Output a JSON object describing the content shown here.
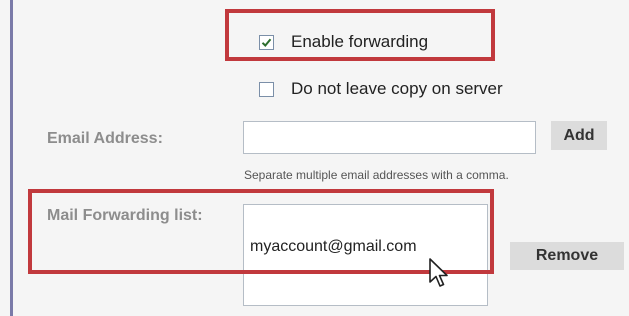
{
  "forwarding": {
    "enable_label": "Enable forwarding",
    "enable_checked": true,
    "no_copy_label": "Do not leave copy on server",
    "no_copy_checked": false
  },
  "email": {
    "label": "Email Address:",
    "value": "",
    "add_label": "Add",
    "hint": "Separate multiple email addresses with a comma."
  },
  "forwarding_list": {
    "label": "Mail Forwarding list:",
    "items": [
      "myaccount@gmail.com"
    ],
    "remove_label": "Remove"
  },
  "colors": {
    "highlight": "#c1393d",
    "panel_background": "#f5f5f5",
    "button_background": "#dcdcdc",
    "label_gray": "#8d8d8d"
  }
}
